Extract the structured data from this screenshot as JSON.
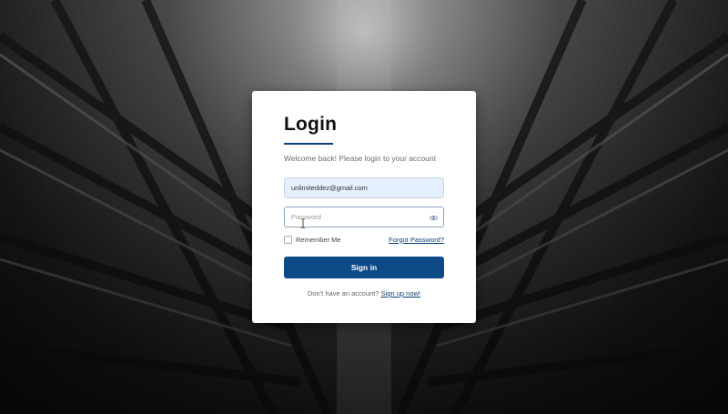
{
  "login": {
    "title": "Login",
    "subtitle": "Welcome back! Please login to your account",
    "email_value": "unlimiteddez@gmail.com",
    "password_placeholder": "Password",
    "remember_label": "Remember Me",
    "forgot_label": "Forgot Password?",
    "signin_label": "Sign in",
    "signup_prompt": "Don't have an account?",
    "signup_link": "Sign up now!"
  },
  "colors": {
    "accent": "#0d4a86",
    "link": "#0d3f79",
    "email_bg": "#e6effd"
  },
  "icons": {
    "password_toggle": "eye-icon",
    "cursor": "text-cursor-icon"
  }
}
